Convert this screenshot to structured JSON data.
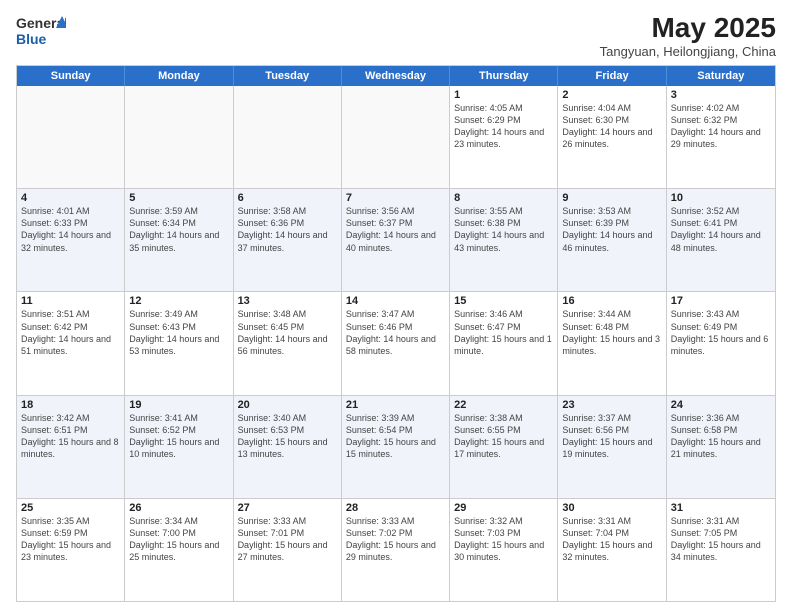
{
  "header": {
    "logo_general": "General",
    "logo_blue": "Blue",
    "month_year": "May 2025",
    "location": "Tangyuan, Heilongjiang, China"
  },
  "day_headers": [
    "Sunday",
    "Monday",
    "Tuesday",
    "Wednesday",
    "Thursday",
    "Friday",
    "Saturday"
  ],
  "weeks": [
    [
      {
        "day": "",
        "info": "",
        "empty": true
      },
      {
        "day": "",
        "info": "",
        "empty": true
      },
      {
        "day": "",
        "info": "",
        "empty": true
      },
      {
        "day": "",
        "info": "",
        "empty": true
      },
      {
        "day": "1",
        "info": "Sunrise: 4:05 AM\nSunset: 6:29 PM\nDaylight: 14 hours\nand 23 minutes.",
        "empty": false
      },
      {
        "day": "2",
        "info": "Sunrise: 4:04 AM\nSunset: 6:30 PM\nDaylight: 14 hours\nand 26 minutes.",
        "empty": false
      },
      {
        "day": "3",
        "info": "Sunrise: 4:02 AM\nSunset: 6:32 PM\nDaylight: 14 hours\nand 29 minutes.",
        "empty": false
      }
    ],
    [
      {
        "day": "4",
        "info": "Sunrise: 4:01 AM\nSunset: 6:33 PM\nDaylight: 14 hours\nand 32 minutes.",
        "empty": false
      },
      {
        "day": "5",
        "info": "Sunrise: 3:59 AM\nSunset: 6:34 PM\nDaylight: 14 hours\nand 35 minutes.",
        "empty": false
      },
      {
        "day": "6",
        "info": "Sunrise: 3:58 AM\nSunset: 6:36 PM\nDaylight: 14 hours\nand 37 minutes.",
        "empty": false
      },
      {
        "day": "7",
        "info": "Sunrise: 3:56 AM\nSunset: 6:37 PM\nDaylight: 14 hours\nand 40 minutes.",
        "empty": false
      },
      {
        "day": "8",
        "info": "Sunrise: 3:55 AM\nSunset: 6:38 PM\nDaylight: 14 hours\nand 43 minutes.",
        "empty": false
      },
      {
        "day": "9",
        "info": "Sunrise: 3:53 AM\nSunset: 6:39 PM\nDaylight: 14 hours\nand 46 minutes.",
        "empty": false
      },
      {
        "day": "10",
        "info": "Sunrise: 3:52 AM\nSunset: 6:41 PM\nDaylight: 14 hours\nand 48 minutes.",
        "empty": false
      }
    ],
    [
      {
        "day": "11",
        "info": "Sunrise: 3:51 AM\nSunset: 6:42 PM\nDaylight: 14 hours\nand 51 minutes.",
        "empty": false
      },
      {
        "day": "12",
        "info": "Sunrise: 3:49 AM\nSunset: 6:43 PM\nDaylight: 14 hours\nand 53 minutes.",
        "empty": false
      },
      {
        "day": "13",
        "info": "Sunrise: 3:48 AM\nSunset: 6:45 PM\nDaylight: 14 hours\nand 56 minutes.",
        "empty": false
      },
      {
        "day": "14",
        "info": "Sunrise: 3:47 AM\nSunset: 6:46 PM\nDaylight: 14 hours\nand 58 minutes.",
        "empty": false
      },
      {
        "day": "15",
        "info": "Sunrise: 3:46 AM\nSunset: 6:47 PM\nDaylight: 15 hours\nand 1 minute.",
        "empty": false
      },
      {
        "day": "16",
        "info": "Sunrise: 3:44 AM\nSunset: 6:48 PM\nDaylight: 15 hours\nand 3 minutes.",
        "empty": false
      },
      {
        "day": "17",
        "info": "Sunrise: 3:43 AM\nSunset: 6:49 PM\nDaylight: 15 hours\nand 6 minutes.",
        "empty": false
      }
    ],
    [
      {
        "day": "18",
        "info": "Sunrise: 3:42 AM\nSunset: 6:51 PM\nDaylight: 15 hours\nand 8 minutes.",
        "empty": false
      },
      {
        "day": "19",
        "info": "Sunrise: 3:41 AM\nSunset: 6:52 PM\nDaylight: 15 hours\nand 10 minutes.",
        "empty": false
      },
      {
        "day": "20",
        "info": "Sunrise: 3:40 AM\nSunset: 6:53 PM\nDaylight: 15 hours\nand 13 minutes.",
        "empty": false
      },
      {
        "day": "21",
        "info": "Sunrise: 3:39 AM\nSunset: 6:54 PM\nDaylight: 15 hours\nand 15 minutes.",
        "empty": false
      },
      {
        "day": "22",
        "info": "Sunrise: 3:38 AM\nSunset: 6:55 PM\nDaylight: 15 hours\nand 17 minutes.",
        "empty": false
      },
      {
        "day": "23",
        "info": "Sunrise: 3:37 AM\nSunset: 6:56 PM\nDaylight: 15 hours\nand 19 minutes.",
        "empty": false
      },
      {
        "day": "24",
        "info": "Sunrise: 3:36 AM\nSunset: 6:58 PM\nDaylight: 15 hours\nand 21 minutes.",
        "empty": false
      }
    ],
    [
      {
        "day": "25",
        "info": "Sunrise: 3:35 AM\nSunset: 6:59 PM\nDaylight: 15 hours\nand 23 minutes.",
        "empty": false
      },
      {
        "day": "26",
        "info": "Sunrise: 3:34 AM\nSunset: 7:00 PM\nDaylight: 15 hours\nand 25 minutes.",
        "empty": false
      },
      {
        "day": "27",
        "info": "Sunrise: 3:33 AM\nSunset: 7:01 PM\nDaylight: 15 hours\nand 27 minutes.",
        "empty": false
      },
      {
        "day": "28",
        "info": "Sunrise: 3:33 AM\nSunset: 7:02 PM\nDaylight: 15 hours\nand 29 minutes.",
        "empty": false
      },
      {
        "day": "29",
        "info": "Sunrise: 3:32 AM\nSunset: 7:03 PM\nDaylight: 15 hours\nand 30 minutes.",
        "empty": false
      },
      {
        "day": "30",
        "info": "Sunrise: 3:31 AM\nSunset: 7:04 PM\nDaylight: 15 hours\nand 32 minutes.",
        "empty": false
      },
      {
        "day": "31",
        "info": "Sunrise: 3:31 AM\nSunset: 7:05 PM\nDaylight: 15 hours\nand 34 minutes.",
        "empty": false
      }
    ]
  ]
}
